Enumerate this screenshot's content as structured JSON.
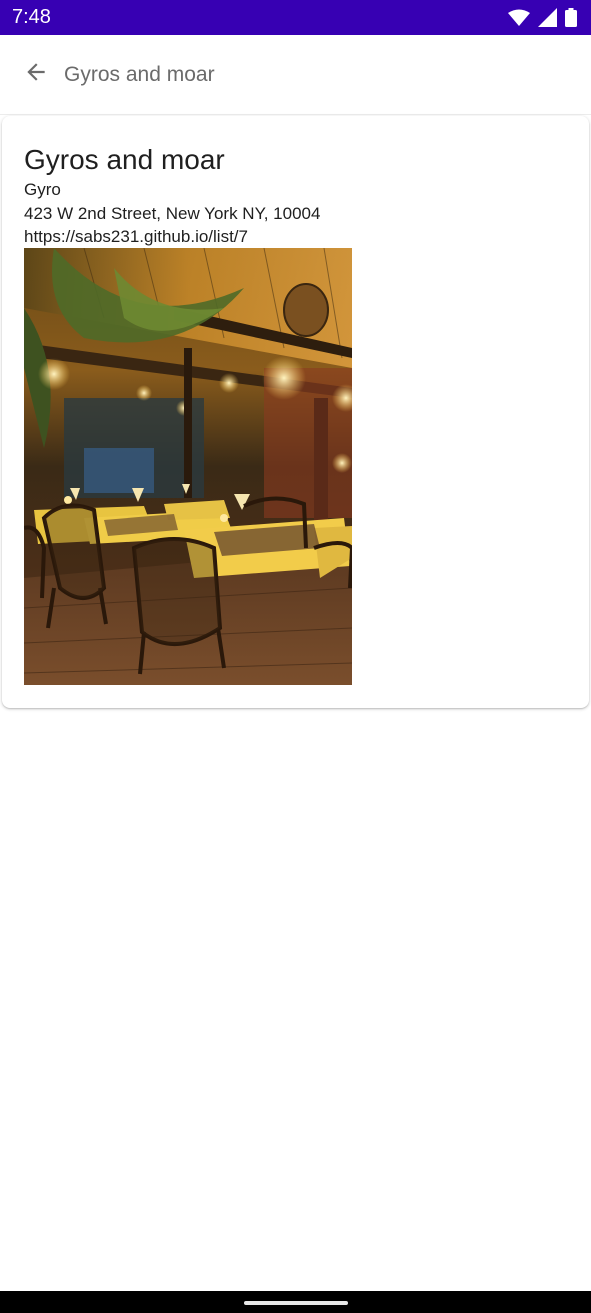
{
  "status_bar": {
    "time": "7:48",
    "icons": [
      "wifi-icon",
      "cell-signal-icon",
      "battery-icon"
    ],
    "background": "#3700b3"
  },
  "app_bar": {
    "back_icon": "arrow-back-icon",
    "title": "Gyros and moar"
  },
  "restaurant": {
    "name": "Gyros and moar",
    "cuisine": "Gyro",
    "address": "423 W 2nd Street, New York NY, 10004",
    "url": "https://sabs231.github.io/list/7",
    "photo_subject": "restaurant-interior-photo"
  },
  "nav_bar": {
    "handle": "home-handle"
  }
}
